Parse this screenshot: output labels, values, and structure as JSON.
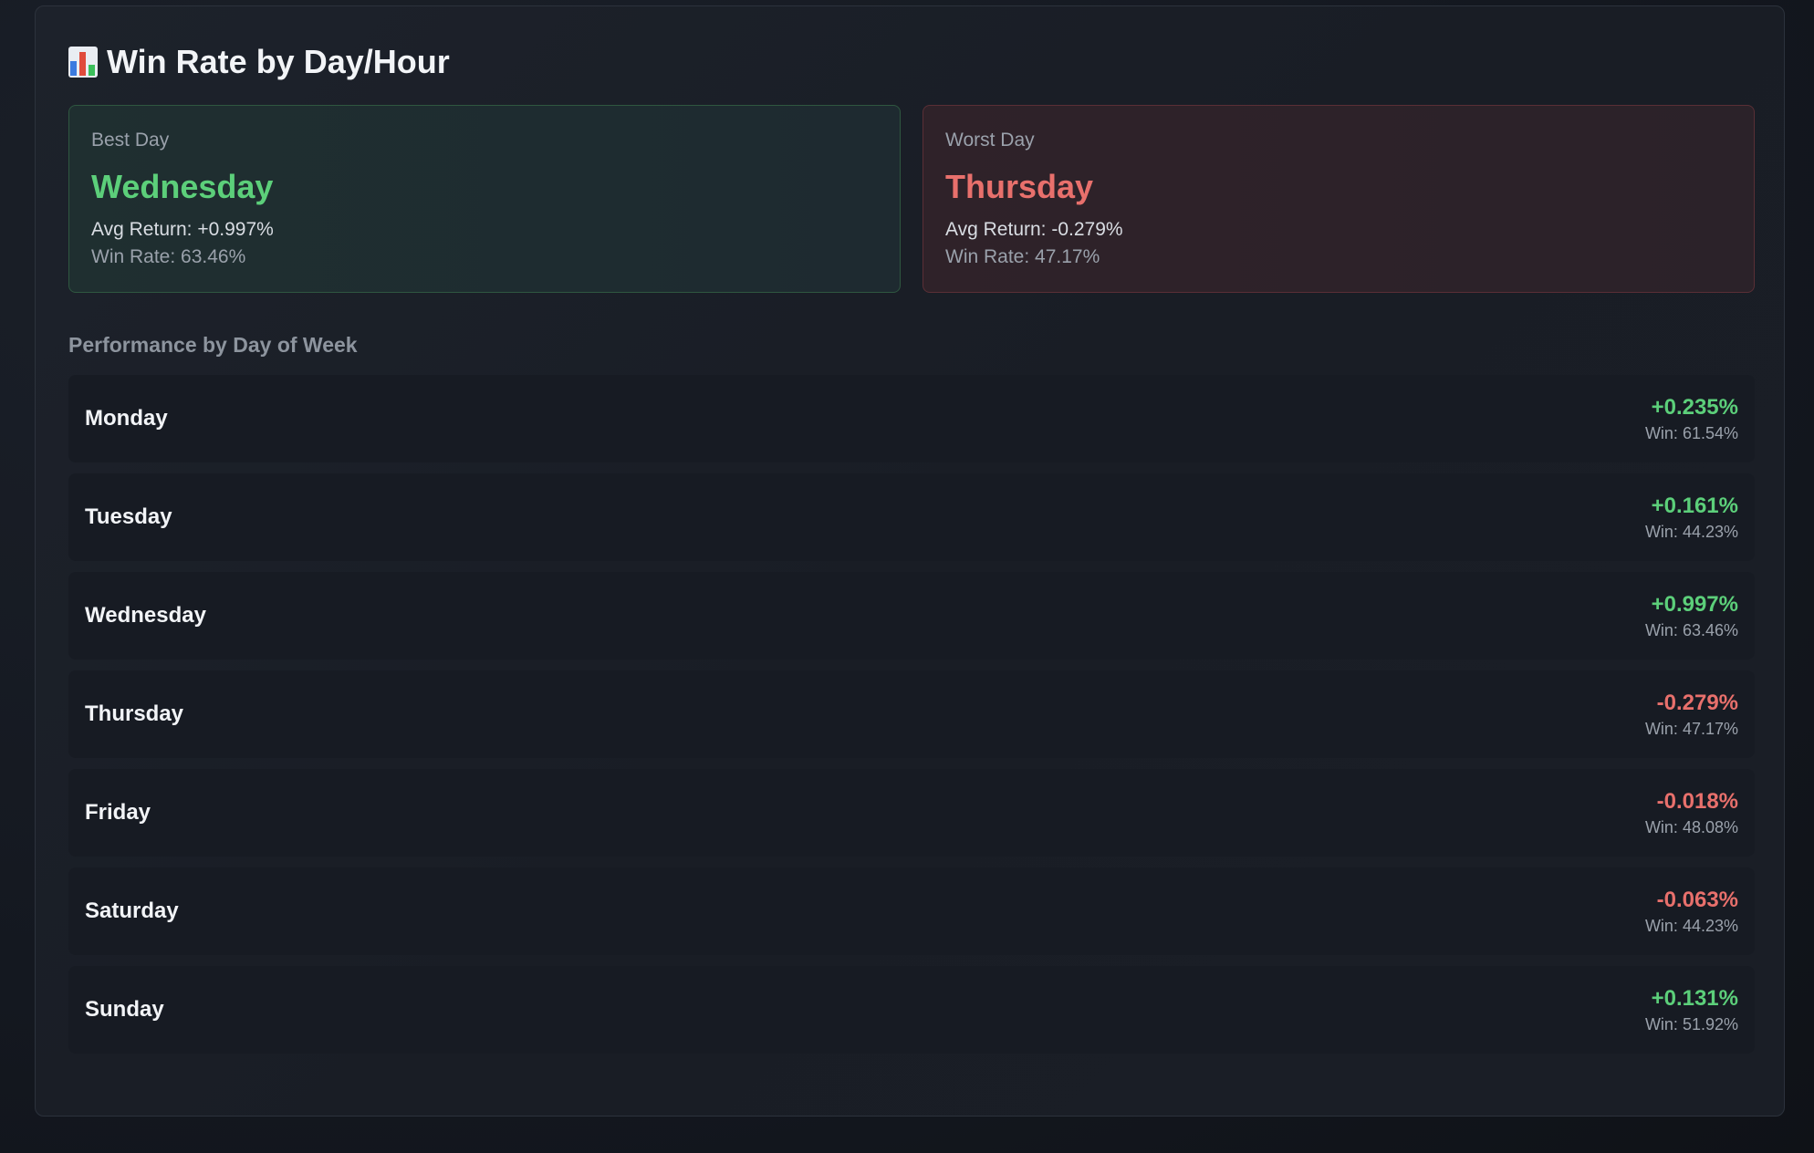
{
  "title": "Win Rate by Day/Hour",
  "icon": "bar-chart-icon",
  "colors": {
    "positive": "#5ccf7a",
    "negative": "#e8706c"
  },
  "best": {
    "label": "Best Day",
    "day": "Wednesday",
    "avg_return": "Avg Return: +0.997%",
    "win_rate": "Win Rate: 63.46%"
  },
  "worst": {
    "label": "Worst Day",
    "day": "Thursday",
    "avg_return": "Avg Return: -0.279%",
    "win_rate": "Win Rate: 47.17%"
  },
  "section_heading": "Performance by Day of Week",
  "days": [
    {
      "day": "Monday",
      "return": "+0.235%",
      "win": "Win: 61.54%",
      "sign": "pos"
    },
    {
      "day": "Tuesday",
      "return": "+0.161%",
      "win": "Win: 44.23%",
      "sign": "pos"
    },
    {
      "day": "Wednesday",
      "return": "+0.997%",
      "win": "Win: 63.46%",
      "sign": "pos"
    },
    {
      "day": "Thursday",
      "return": "-0.279%",
      "win": "Win: 47.17%",
      "sign": "neg"
    },
    {
      "day": "Friday",
      "return": "-0.018%",
      "win": "Win: 48.08%",
      "sign": "neg"
    },
    {
      "day": "Saturday",
      "return": "-0.063%",
      "win": "Win: 44.23%",
      "sign": "neg"
    },
    {
      "day": "Sunday",
      "return": "+0.131%",
      "win": "Win: 51.92%",
      "sign": "pos"
    }
  ]
}
